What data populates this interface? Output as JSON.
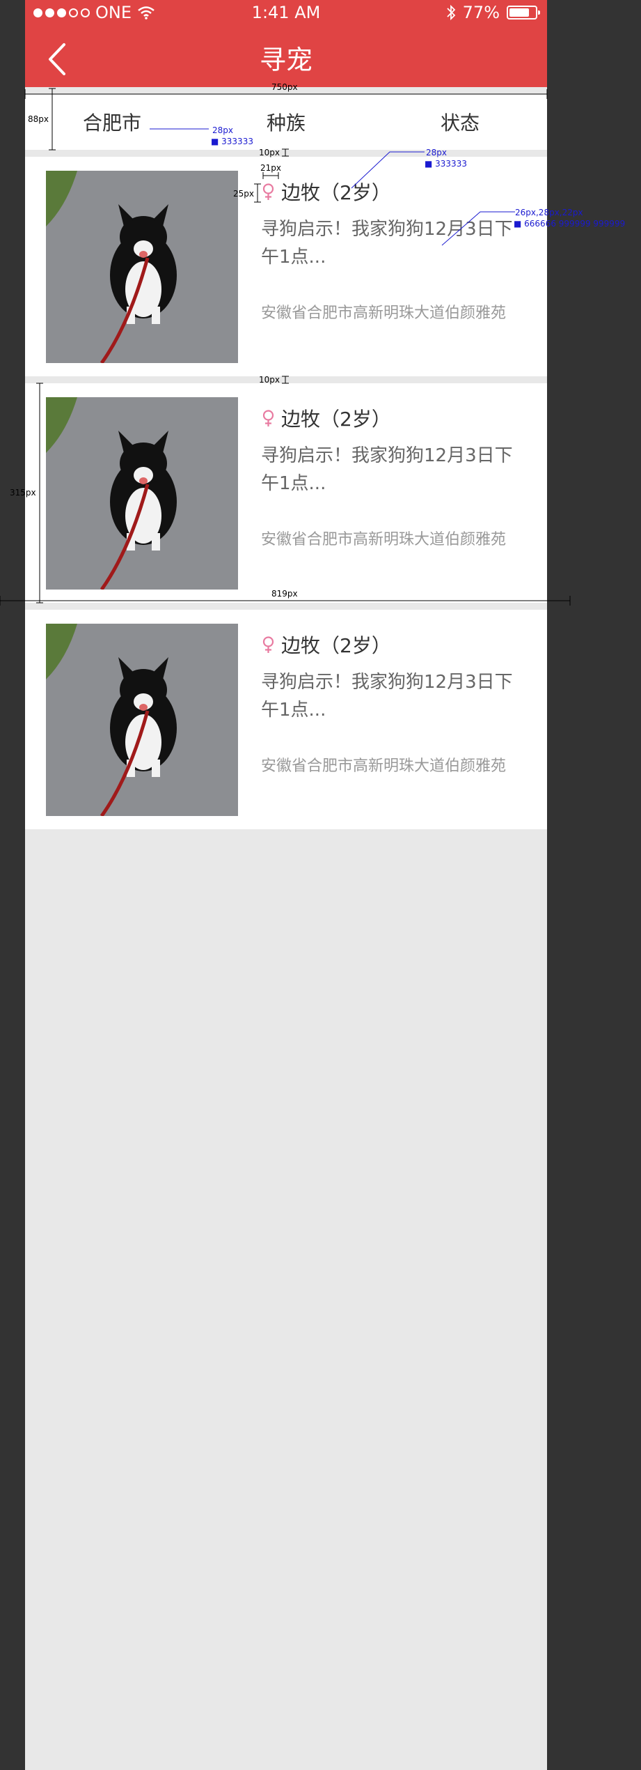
{
  "statusbar": {
    "carrier": "ONE",
    "time": "1:41 AM",
    "battery_pct": "77%",
    "battery_level": 0.77
  },
  "nav": {
    "title": "寻宠"
  },
  "filters": [
    {
      "label": "合肥市"
    },
    {
      "label": "种族"
    },
    {
      "label": "状态"
    }
  ],
  "pets": [
    {
      "name": "边牧（2岁）",
      "desc": "寻狗启示！我家狗狗12月3日下午1点...",
      "address": "安徽省合肥市高新明珠大道伯颜雅苑"
    },
    {
      "name": "边牧（2岁）",
      "desc": "寻狗启示！我家狗狗12月3日下午1点...",
      "address": "安徽省合肥市高新明珠大道伯颜雅苑"
    },
    {
      "name": "边牧（2岁）",
      "desc": "寻狗启示！我家狗狗12月3日下午1点...",
      "address": "安徽省合肥市高新明珠大道伯颜雅苑"
    }
  ],
  "annotations": {
    "w750": "750px",
    "h88": "88px",
    "fs28": "28px",
    "c333": "333333",
    "gap10": "10px",
    "w21": "21px",
    "h25": "25px",
    "fs28b": "28px",
    "c333b": "333333",
    "fs_multi": "26px,28px,22px",
    "c_multi": "666666 999999 999999",
    "gap10b": "10px",
    "h315": "315px",
    "w819": "819px"
  },
  "colors": {
    "header": "#e04444",
    "text_primary": "#333333",
    "text_secondary": "#666666",
    "text_tertiary": "#999999",
    "female_icon": "#e87aa0"
  }
}
